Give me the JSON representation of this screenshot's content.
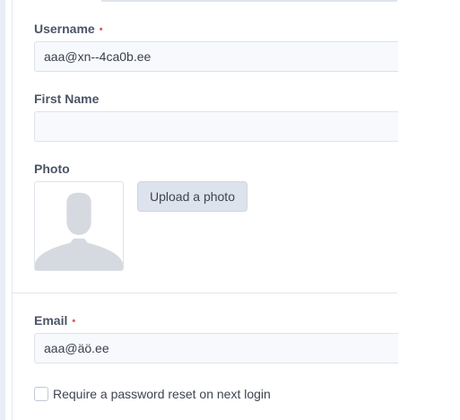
{
  "form": {
    "username": {
      "label": "Username",
      "required_mark": "•",
      "value": "aaa@xn--4ca0b.ee"
    },
    "first_name": {
      "label": "First Name",
      "value": ""
    },
    "photo": {
      "label": "Photo",
      "upload_button": "Upload a photo",
      "avatar_icon": "user-silhouette-icon"
    },
    "email": {
      "label": "Email",
      "required_mark": "•",
      "value": "aaa@äö.ee"
    },
    "password_reset": {
      "label": "Require a password reset on next login",
      "checked": false
    }
  },
  "colors": {
    "label_text": "#4c5466",
    "required_mark": "#e05a5a",
    "input_bg": "#f7f9fc",
    "button_bg": "#dde3ec",
    "avatar_fill": "#d6d9df"
  }
}
